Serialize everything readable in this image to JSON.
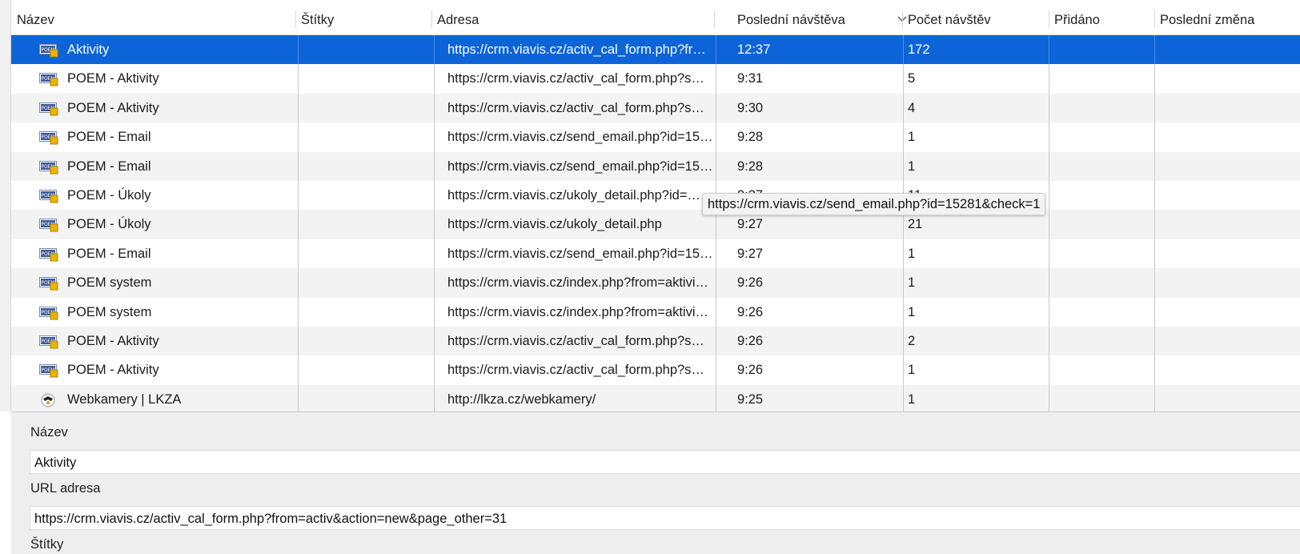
{
  "table": {
    "columns": [
      "Název",
      "Štítky",
      "Adresa",
      "Poslední návštěva",
      "Počet návštěv",
      "Přidáno",
      "Poslední změna"
    ],
    "rows": [
      {
        "icon": "poem-favicon",
        "name": "Aktivity",
        "tags": "",
        "address": "https://crm.viavis.cz/activ_cal_form.php?fr…",
        "last_visit": "12:37",
        "visits": "172",
        "added": "",
        "modified": ""
      },
      {
        "icon": "poem-favicon",
        "name": "POEM - Aktivity",
        "tags": "",
        "address": "https://crm.viavis.cz/activ_cal_form.php?s…",
        "last_visit": "9:31",
        "visits": "5",
        "added": "",
        "modified": ""
      },
      {
        "icon": "poem-favicon",
        "name": "POEM - Aktivity",
        "tags": "",
        "address": "https://crm.viavis.cz/activ_cal_form.php?s…",
        "last_visit": "9:30",
        "visits": "4",
        "added": "",
        "modified": ""
      },
      {
        "icon": "poem-favicon",
        "name": "POEM - Email",
        "tags": "",
        "address": "https://crm.viavis.cz/send_email.php?id=15…",
        "last_visit": "9:28",
        "visits": "1",
        "added": "",
        "modified": ""
      },
      {
        "icon": "poem-favicon",
        "name": "POEM - Email",
        "tags": "",
        "address": "https://crm.viavis.cz/send_email.php?id=15…",
        "last_visit": "9:28",
        "visits": "1",
        "added": "",
        "modified": ""
      },
      {
        "icon": "poem-favicon",
        "name": "POEM - Úkoly",
        "tags": "",
        "address": "https://crm.viavis.cz/ukoly_detail.php?id=…",
        "last_visit": "9:27",
        "visits": "11",
        "added": "",
        "modified": ""
      },
      {
        "icon": "poem-favicon",
        "name": "POEM - Úkoly",
        "tags": "",
        "address": "https://crm.viavis.cz/ukoly_detail.php",
        "last_visit": "9:27",
        "visits": "21",
        "added": "",
        "modified": ""
      },
      {
        "icon": "poem-favicon",
        "name": "POEM - Email",
        "tags": "",
        "address": "https://crm.viavis.cz/send_email.php?id=15…",
        "last_visit": "9:27",
        "visits": "1",
        "added": "",
        "modified": ""
      },
      {
        "icon": "poem-favicon",
        "name": "POEM system",
        "tags": "",
        "address": "https://crm.viavis.cz/index.php?from=aktivi…",
        "last_visit": "9:26",
        "visits": "1",
        "added": "",
        "modified": ""
      },
      {
        "icon": "poem-favicon",
        "name": "POEM system",
        "tags": "",
        "address": "https://crm.viavis.cz/index.php?from=aktivi…",
        "last_visit": "9:26",
        "visits": "1",
        "added": "",
        "modified": ""
      },
      {
        "icon": "poem-favicon",
        "name": "POEM - Aktivity",
        "tags": "",
        "address": "https://crm.viavis.cz/activ_cal_form.php?s…",
        "last_visit": "9:26",
        "visits": "2",
        "added": "",
        "modified": ""
      },
      {
        "icon": "poem-favicon",
        "name": "POEM - Aktivity",
        "tags": "",
        "address": "https://crm.viavis.cz/activ_cal_form.php?s…",
        "last_visit": "9:26",
        "visits": "1",
        "added": "",
        "modified": ""
      },
      {
        "icon": "lkza-favicon",
        "name": "Webkamery | LKZA",
        "tags": "",
        "address": "http://lkza.cz/webkamery/",
        "last_visit": "9:25",
        "visits": "1",
        "added": "",
        "modified": ""
      }
    ]
  },
  "tooltip": {
    "text": "https://crm.viavis.cz/send_email.php?id=15281&check=1"
  },
  "details": {
    "name_label": "Název",
    "name_value": "Aktivity",
    "url_label": "URL adresa",
    "url_value": "https://crm.viavis.cz/activ_cal_form.php?from=activ&action=new&page_other=31",
    "tags_label": "Štítky"
  },
  "colors": {
    "selection": "#0d64d9",
    "alt_row": "#f3f3f3"
  }
}
